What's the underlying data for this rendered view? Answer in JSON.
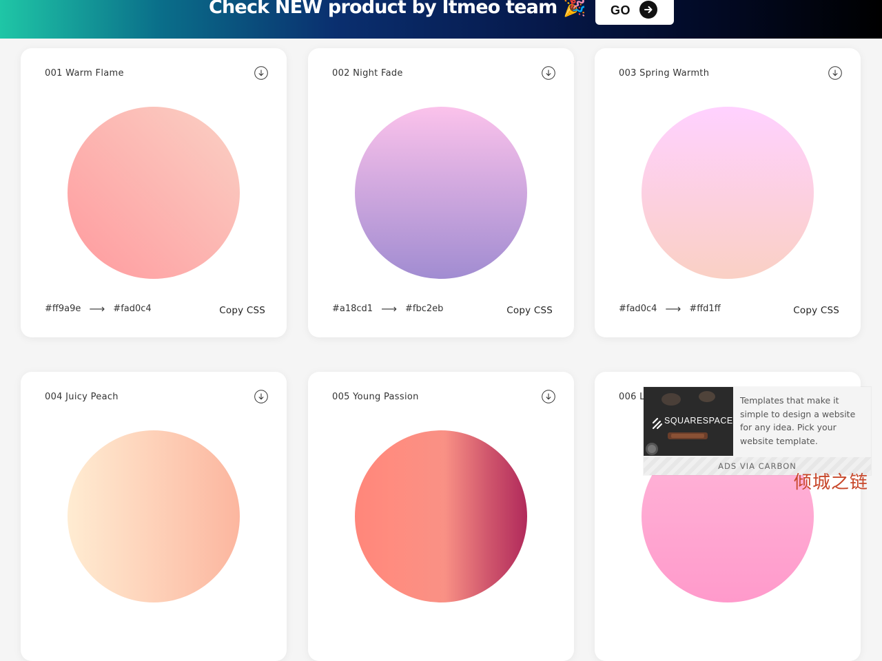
{
  "banner": {
    "text": "Check NEW product by Itmeo team 🎉",
    "go_label": "GO"
  },
  "cards": [
    {
      "title": "001 Warm Flame",
      "from": "#ff9a9e",
      "to": "#fad0c4",
      "copy": "Copy CSS",
      "icon": "download-icon"
    },
    {
      "title": "002 Night Fade",
      "from": "#a18cd1",
      "to": "#fbc2eb",
      "copy": "Copy CSS",
      "icon": "download-icon"
    },
    {
      "title": "003 Spring Warmth",
      "from": "#fad0c4",
      "to": "#ffd1ff",
      "copy": "Copy CSS",
      "icon": "download-icon"
    },
    {
      "title": "004 Juicy Peach",
      "icon": "download-icon"
    },
    {
      "title": "005 Young Passion",
      "icon": "download-icon"
    },
    {
      "title": "006 L",
      "icon": "download-icon"
    }
  ],
  "arrow_glyph": "⟶",
  "ad": {
    "brand": "SQUARESPACE",
    "text": "Templates that make it simple to design a website for any idea. Pick your website template.",
    "footer": "ADS VIA CARBON"
  },
  "watermark": "倾城之链",
  "colors": {
    "warm_flame": [
      "#ff9a9e",
      "#fad0c4"
    ],
    "night_fade": [
      "#a18cd1",
      "#fbc2eb"
    ],
    "spring_warmth": [
      "#fad0c4",
      "#ffd1ff"
    ],
    "juicy_peach": [
      "#ffecd2",
      "#fcb69f"
    ],
    "young_passion": [
      "#ff8177",
      "#b12a5b"
    ],
    "card6": [
      "#ff9acb",
      "#ffb7d9"
    ]
  }
}
